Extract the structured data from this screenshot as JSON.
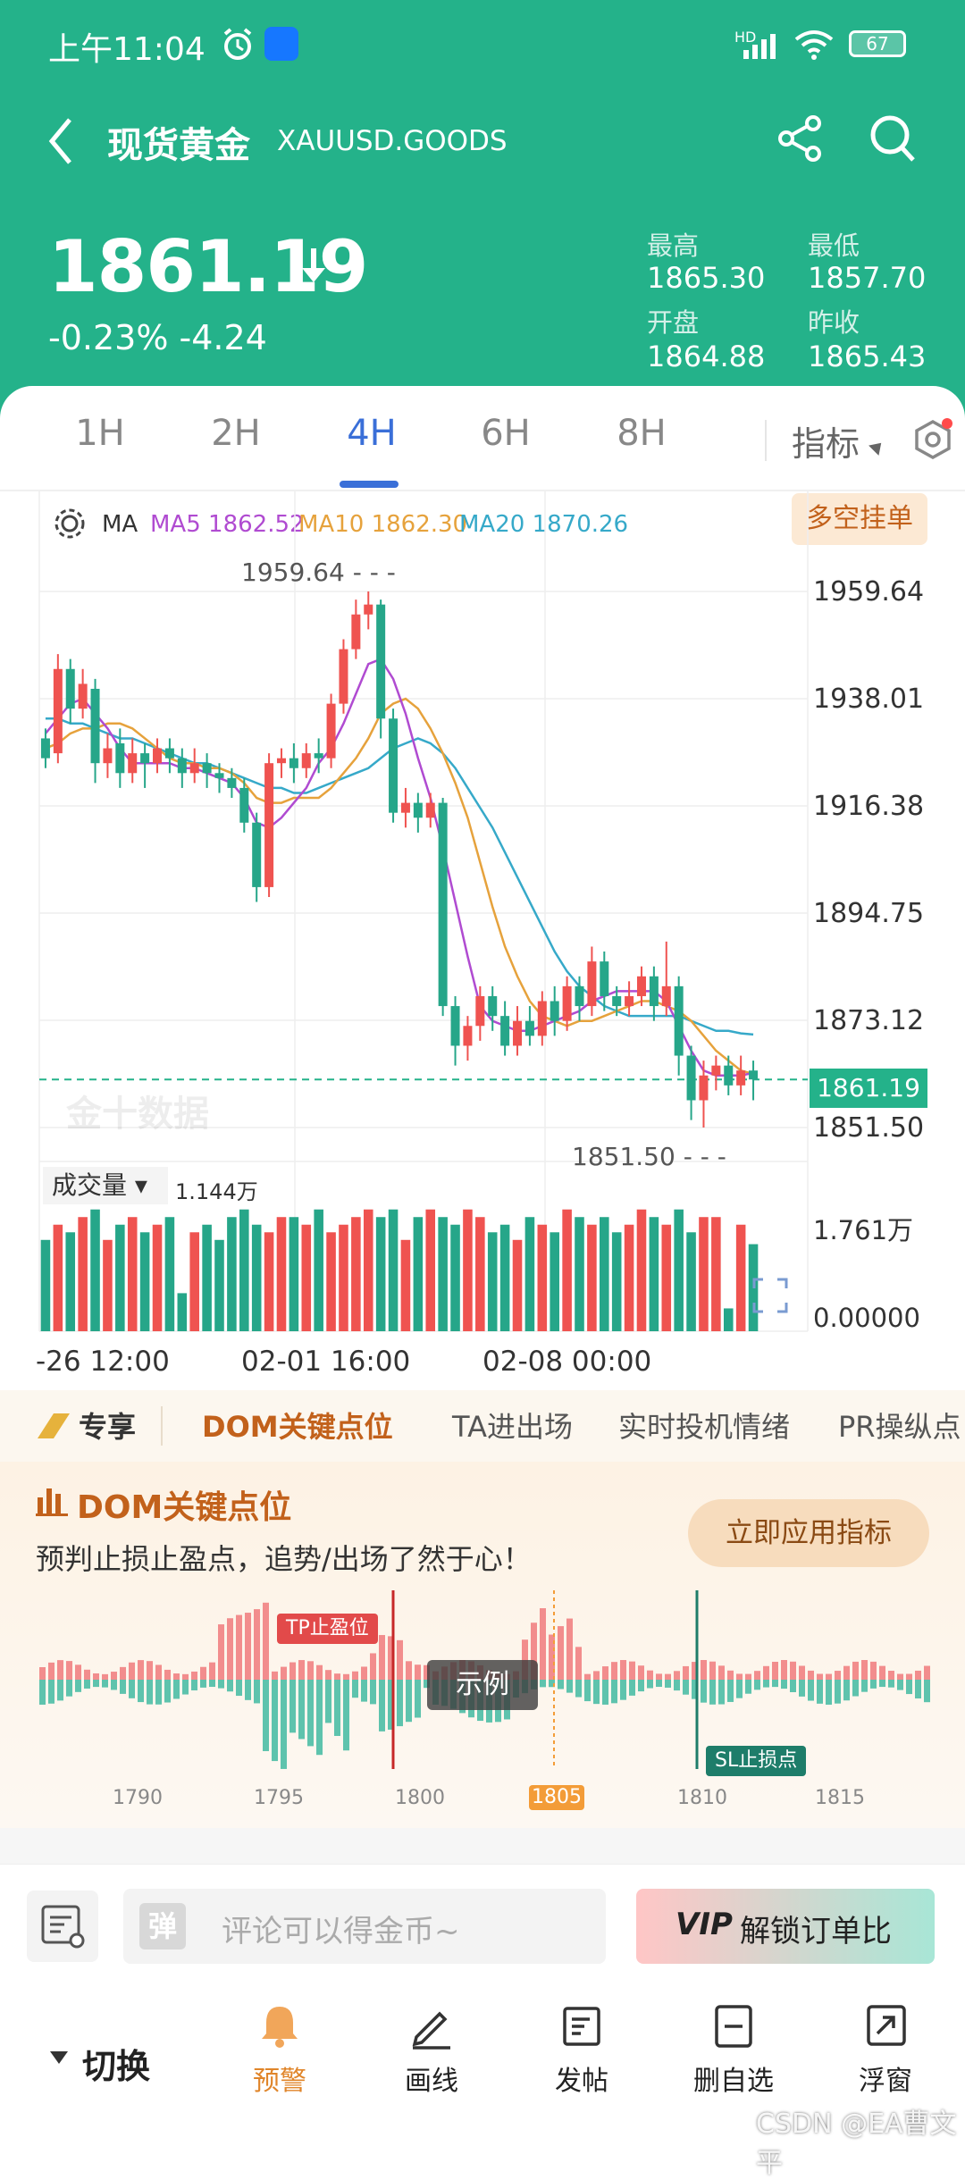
{
  "status_bar": {
    "time": "上午11:04",
    "battery": "67",
    "network": "HD"
  },
  "header": {
    "title": "现货黄金",
    "symbol": "XAUUSD.GOODS",
    "price": "1861.19",
    "change": "-0.23% -4.24",
    "high_label": "最高",
    "high": "1865.30",
    "low_label": "最低",
    "low": "1857.70",
    "open_label": "开盘",
    "open": "1864.88",
    "prev_close_label": "昨收",
    "prev_close": "1865.43",
    "accent": "#24b28a"
  },
  "tabs": [
    "1H",
    "2H",
    "4H",
    "6H",
    "8H"
  ],
  "active_tab": "4H",
  "indicator_label": "指标",
  "chart_header": {
    "ma": "MA",
    "ma5": "MA5 1862.52",
    "ma10": "MA10 1862.30",
    "ma20": "MA20 1870.26",
    "order_button": "多空挂单"
  },
  "chart_data": {
    "type": "candlestick",
    "y_ticks": [
      "1959.64",
      "1938.01",
      "1916.38",
      "1894.75",
      "1873.12",
      "1851.50"
    ],
    "ylim": [
      1851.5,
      1959.64
    ],
    "max_marker": "1959.64",
    "min_marker": "1851.50",
    "last_price": "1861.19",
    "x_ticks": [
      "-26 12:00",
      "02-01 16:00",
      "02-08 00:00"
    ],
    "watermark": "金十数据",
    "candles": [
      {
        "o": 1930,
        "c": 1926,
        "h": 1932,
        "l": 1924
      },
      {
        "o": 1927,
        "c": 1944,
        "h": 1947,
        "l": 1925
      },
      {
        "o": 1944,
        "c": 1936,
        "h": 1946,
        "l": 1933
      },
      {
        "o": 1936,
        "c": 1941,
        "h": 1944,
        "l": 1934
      },
      {
        "o": 1940,
        "c": 1925,
        "h": 1942,
        "l": 1921
      },
      {
        "o": 1925,
        "c": 1928,
        "h": 1931,
        "l": 1922
      },
      {
        "o": 1929,
        "c": 1923,
        "h": 1932,
        "l": 1920
      },
      {
        "o": 1923,
        "c": 1927,
        "h": 1930,
        "l": 1921
      },
      {
        "o": 1927,
        "c": 1925,
        "h": 1929,
        "l": 1920
      },
      {
        "o": 1925,
        "c": 1928,
        "h": 1930,
        "l": 1923
      },
      {
        "o": 1928,
        "c": 1926,
        "h": 1930,
        "l": 1923
      },
      {
        "o": 1926,
        "c": 1923,
        "h": 1928,
        "l": 1920
      },
      {
        "o": 1923,
        "c": 1925,
        "h": 1928,
        "l": 1921
      },
      {
        "o": 1925,
        "c": 1923,
        "h": 1927,
        "l": 1920
      },
      {
        "o": 1923,
        "c": 1922,
        "h": 1925,
        "l": 1919
      },
      {
        "o": 1922,
        "c": 1920,
        "h": 1924,
        "l": 1918
      },
      {
        "o": 1920,
        "c": 1913,
        "h": 1922,
        "l": 1911
      },
      {
        "o": 1913,
        "c": 1900,
        "h": 1915,
        "l": 1897
      },
      {
        "o": 1900,
        "c": 1925,
        "h": 1927,
        "l": 1898
      },
      {
        "o": 1925,
        "c": 1926,
        "h": 1928,
        "l": 1922
      },
      {
        "o": 1926,
        "c": 1924,
        "h": 1929,
        "l": 1921
      },
      {
        "o": 1924,
        "c": 1927,
        "h": 1929,
        "l": 1922
      },
      {
        "o": 1927,
        "c": 1926,
        "h": 1930,
        "l": 1923
      },
      {
        "o": 1926,
        "c": 1937,
        "h": 1939,
        "l": 1924
      },
      {
        "o": 1937,
        "c": 1948,
        "h": 1950,
        "l": 1935
      },
      {
        "o": 1948,
        "c": 1955,
        "h": 1958,
        "l": 1946
      },
      {
        "o": 1955,
        "c": 1957,
        "h": 1959.64,
        "l": 1952
      },
      {
        "o": 1957,
        "c": 1934,
        "h": 1958,
        "l": 1930
      },
      {
        "o": 1934,
        "c": 1915,
        "h": 1936,
        "l": 1913
      },
      {
        "o": 1915,
        "c": 1917,
        "h": 1920,
        "l": 1912
      },
      {
        "o": 1917,
        "c": 1914,
        "h": 1919,
        "l": 1911
      },
      {
        "o": 1914,
        "c": 1917,
        "h": 1919,
        "l": 1912
      },
      {
        "o": 1917,
        "c": 1876,
        "h": 1918,
        "l": 1874
      },
      {
        "o": 1876,
        "c": 1868,
        "h": 1878,
        "l": 1864
      },
      {
        "o": 1868,
        "c": 1872,
        "h": 1874,
        "l": 1865
      },
      {
        "o": 1872,
        "c": 1878,
        "h": 1880,
        "l": 1869
      },
      {
        "o": 1878,
        "c": 1874,
        "h": 1880,
        "l": 1871
      },
      {
        "o": 1874,
        "c": 1868,
        "h": 1877,
        "l": 1866
      },
      {
        "o": 1868,
        "c": 1873,
        "h": 1876,
        "l": 1866
      },
      {
        "o": 1873,
        "c": 1870,
        "h": 1876,
        "l": 1868
      },
      {
        "o": 1870,
        "c": 1877,
        "h": 1879,
        "l": 1868
      },
      {
        "o": 1877,
        "c": 1873,
        "h": 1880,
        "l": 1870
      },
      {
        "o": 1873,
        "c": 1880,
        "h": 1882,
        "l": 1871
      },
      {
        "o": 1880,
        "c": 1876,
        "h": 1882,
        "l": 1873
      },
      {
        "o": 1876,
        "c": 1885,
        "h": 1888,
        "l": 1874
      },
      {
        "o": 1885,
        "c": 1878,
        "h": 1887,
        "l": 1875
      },
      {
        "o": 1878,
        "c": 1876,
        "h": 1880,
        "l": 1874
      },
      {
        "o": 1876,
        "c": 1878,
        "h": 1881,
        "l": 1874
      },
      {
        "o": 1878,
        "c": 1882,
        "h": 1884,
        "l": 1876
      },
      {
        "o": 1882,
        "c": 1876,
        "h": 1884,
        "l": 1873
      },
      {
        "o": 1876,
        "c": 1880,
        "h": 1889,
        "l": 1874
      },
      {
        "o": 1880,
        "c": 1866,
        "h": 1882,
        "l": 1862
      },
      {
        "o": 1866,
        "c": 1857,
        "h": 1868,
        "l": 1853
      },
      {
        "o": 1857,
        "c": 1862,
        "h": 1865,
        "l": 1851.5
      },
      {
        "o": 1862,
        "c": 1864,
        "h": 1866,
        "l": 1859
      },
      {
        "o": 1864,
        "c": 1860,
        "h": 1866,
        "l": 1858
      },
      {
        "o": 1860,
        "c": 1863,
        "h": 1866,
        "l": 1858
      },
      {
        "o": 1863,
        "c": 1861.19,
        "h": 1865,
        "l": 1857
      }
    ],
    "ma5": [
      1931,
      1934,
      1937,
      1938,
      1935,
      1932,
      1928,
      1925,
      1925,
      1925,
      1925,
      1924,
      1924,
      1923,
      1922,
      1921,
      1918,
      1913,
      1912,
      1914,
      1917,
      1920,
      1925,
      1928,
      1933,
      1939,
      1945,
      1946,
      1942,
      1935,
      1926,
      1918,
      1908,
      1897,
      1886,
      1876,
      1873,
      1872,
      1871,
      1871,
      1872,
      1873,
      1874,
      1875,
      1877,
      1878,
      1879,
      1879,
      1879,
      1879,
      1877,
      1872,
      1867,
      1863,
      1862,
      1862,
      1862,
      1862.52
    ],
    "ma10": [
      1928,
      1929,
      1931,
      1932,
      1932,
      1933,
      1933,
      1932,
      1930,
      1928,
      1926,
      1925,
      1925,
      1924,
      1924,
      1923,
      1921,
      1918,
      1917,
      1917,
      1918,
      1918,
      1918,
      1920,
      1923,
      1926,
      1930,
      1935,
      1937,
      1938,
      1936,
      1932,
      1927,
      1921,
      1914,
      1905,
      1896,
      1888,
      1882,
      1877,
      1874,
      1873,
      1872,
      1873,
      1873,
      1874,
      1875,
      1876,
      1877,
      1877,
      1876,
      1875,
      1873,
      1870,
      1867,
      1865,
      1863,
      1862.3
    ],
    "ma20": [
      1934,
      1934,
      1933,
      1933,
      1932,
      1931,
      1930,
      1930,
      1929,
      1928,
      1927,
      1926,
      1925,
      1925,
      1924,
      1923,
      1922,
      1921,
      1920,
      1920,
      1919,
      1919,
      1920,
      1921,
      1922,
      1923,
      1924,
      1926,
      1928,
      1929,
      1930,
      1929,
      1927,
      1924,
      1920,
      1916,
      1912,
      1907,
      1902,
      1897,
      1892,
      1887,
      1883,
      1880,
      1878,
      1876,
      1875,
      1874,
      1874,
      1874,
      1874,
      1874,
      1873,
      1872,
      1871,
      1871,
      1870.5,
      1870.26
    ],
    "volume": {
      "label": "成交量",
      "value": "1.144万",
      "y_ticks": [
        "1.761万",
        "0.00000"
      ],
      "values": [
        1.2,
        1.4,
        1.3,
        1.5,
        1.6,
        1.2,
        1.4,
        1.5,
        1.3,
        1.4,
        1.5,
        0.5,
        1.3,
        1.4,
        1.2,
        1.5,
        1.6,
        1.4,
        1.3,
        1.5,
        1.5,
        1.4,
        1.6,
        1.3,
        1.4,
        1.5,
        1.6,
        1.5,
        1.6,
        1.2,
        1.5,
        1.6,
        1.5,
        1.4,
        1.6,
        1.5,
        1.3,
        1.4,
        1.2,
        1.5,
        1.4,
        1.3,
        1.6,
        1.5,
        1.4,
        1.5,
        1.3,
        1.4,
        1.6,
        1.5,
        1.4,
        1.6,
        1.3,
        1.5,
        1.5,
        0.3,
        1.4,
        1.144
      ]
    }
  },
  "feature_tabs": [
    "专享",
    "DOM关键点位",
    "TA进出场",
    "实时投机情绪",
    "PR操纵点"
  ],
  "promo": {
    "title": "DOM关键点位",
    "subtitle": "预判止损止盈点，追势/出场了然于心！",
    "apply_button": "立即应用指标",
    "tp_label": "TP止盈位",
    "sl_label": "SL止损点",
    "example_label": "示例",
    "x_ticks": [
      "1790",
      "1795",
      "1800",
      "1805",
      "1810",
      "1815"
    ],
    "highlight_tick": "1805"
  },
  "comment_bar": {
    "placeholder": "评论可以得金币~",
    "unlock_button": "解锁订单比"
  },
  "bottom_nav": {
    "switch_label": "切换",
    "items": [
      {
        "label": "预警",
        "icon": "bell-icon"
      },
      {
        "label": "画线",
        "icon": "pencil-icon"
      },
      {
        "label": "发帖",
        "icon": "edit-icon"
      },
      {
        "label": "删自选",
        "icon": "minus-square-icon"
      },
      {
        "label": "浮窗",
        "icon": "float-window-icon"
      }
    ]
  },
  "watermark_text": "CSDN @EA曹文平"
}
